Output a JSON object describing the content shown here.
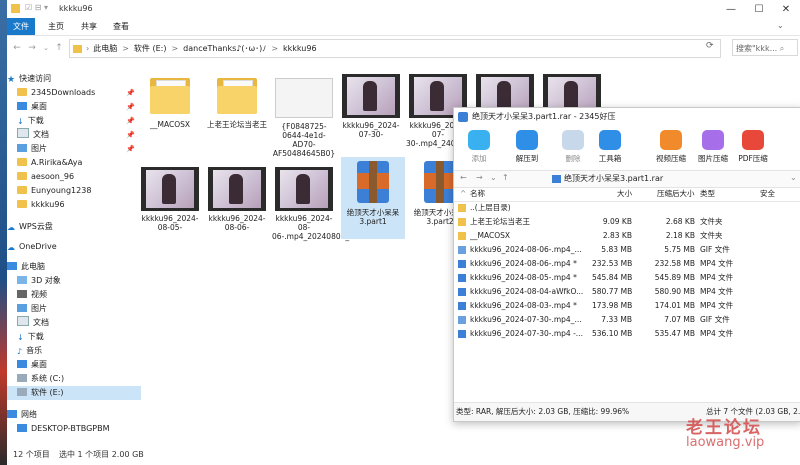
{
  "window": {
    "title": "kkkku96",
    "controls": [
      "—",
      "☐",
      "✕"
    ]
  },
  "ribbon": {
    "tabs": [
      "文件",
      "主页",
      "共享",
      "查看"
    ]
  },
  "address": {
    "parts": [
      "此电脑",
      ">",
      "软件 (E:)",
      ">",
      "danceThanks♪(･ω･)ﾉ",
      ">",
      "kkkku96"
    ],
    "search_placeholder": "搜索\"kkk..."
  },
  "nav": {
    "quick_access": "快速访问",
    "items": [
      {
        "label": "2345Downloads",
        "pinned": true,
        "icon": "folder-icon"
      },
      {
        "label": "桌面",
        "pinned": true,
        "icon": "desktop-icon"
      },
      {
        "label": "下载",
        "pinned": true,
        "icon": "download-icon"
      },
      {
        "label": "文档",
        "pinned": true,
        "icon": "document-icon"
      },
      {
        "label": "图片",
        "pinned": true,
        "icon": "picture-icon"
      },
      {
        "label": "A.Ririka&Aya",
        "pinned": false,
        "icon": "folder-icon"
      },
      {
        "label": "aesoon_96",
        "pinned": false,
        "icon": "folder-icon"
      },
      {
        "label": "Eunyoung1238",
        "pinned": false,
        "icon": "folder-icon"
      },
      {
        "label": "kkkku96",
        "pinned": false,
        "icon": "folder-icon"
      }
    ],
    "wps": "WPS云盘",
    "onedrive": "OneDrive",
    "this_pc": "此电脑",
    "pc_items": [
      "3D 对象",
      "视频",
      "图片",
      "文档",
      "下载",
      "音乐",
      "桌面",
      "系统 (C:)",
      "软件 (E:)"
    ],
    "network": "网络",
    "network_items": [
      "DESKTOP-BTBGPBM"
    ]
  },
  "files": [
    {
      "name": "__MACOSX",
      "kind": "folder"
    },
    {
      "name": "上老王论坛当老王",
      "kind": "folder"
    },
    {
      "name": "{F0848725-0644-4e1d-AD70-AF50484645B0}",
      "kind": "image"
    },
    {
      "name": "kkkku96_2024-07-30-",
      "kind": "video"
    },
    {
      "name": "kkkku96_2024-07-30-.mp4_240807_204...",
      "kind": "video"
    },
    {
      "name": "",
      "kind": "video"
    },
    {
      "name": "",
      "kind": "video"
    },
    {
      "name": "kkkku96_2024-08-05-",
      "kind": "video"
    },
    {
      "name": "kkkku96_2024-08-06-",
      "kind": "video"
    },
    {
      "name": "kkkku96_2024-08-06-.mp4_20240807_204948",
      "kind": "video"
    },
    {
      "name": "绝顶天才小呆呆3.part1",
      "kind": "rar",
      "selected": true
    },
    {
      "name": "绝顶天才小呆呆3.part2",
      "kind": "rar"
    }
  ],
  "status": {
    "count": "12 个项目",
    "selected": "选中 1 个项目  2.00 GB"
  },
  "rar": {
    "title": "绝顶天才小呆呆3.part1.rar - 2345好压",
    "toolbar": [
      "添加",
      "解压到",
      "删除",
      "工具箱",
      "视频压缩",
      "图片压缩",
      "PDF压缩"
    ],
    "path": "绝顶天才小呆呆3.part1.rar",
    "headers": [
      "名称",
      "大小",
      "压缩后大小",
      "类型",
      "安全"
    ],
    "rows": [
      {
        "name": "..(上层目录)",
        "size": "",
        "packed": "",
        "type": "",
        "icon": "up"
      },
      {
        "name": "上老王论坛当老王",
        "size": "9.09 KB",
        "packed": "2.68 KB",
        "type": "文件夹",
        "icon": "folder"
      },
      {
        "name": "__MACOSX",
        "size": "2.83 KB",
        "packed": "2.18 KB",
        "type": "文件夹",
        "icon": "folder"
      },
      {
        "name": "kkkku96_2024-08-06-.mp4_...",
        "size": "5.83 MB",
        "packed": "5.75 MB",
        "type": "GIF 文件",
        "icon": "gif"
      },
      {
        "name": "kkkku96_2024-08-06-.mp4 *",
        "size": "232.53 MB",
        "packed": "232.58 MB",
        "type": "MP4 文件",
        "icon": "mp4"
      },
      {
        "name": "kkkku96_2024-08-05-.mp4 *",
        "size": "545.84 MB",
        "packed": "545.89 MB",
        "type": "MP4 文件",
        "icon": "mp4"
      },
      {
        "name": "kkkku96_2024-08-04-aWfkO...",
        "size": "580.77 MB",
        "packed": "580.90 MB",
        "type": "MP4 文件",
        "icon": "mp4"
      },
      {
        "name": "kkkku96_2024-08-03-.mp4 *",
        "size": "173.98 MB",
        "packed": "174.01 MB",
        "type": "MP4 文件",
        "icon": "mp4"
      },
      {
        "name": "kkkku96_2024-07-30-.mp4_...",
        "size": "7.33 MB",
        "packed": "7.07 MB",
        "type": "GIF 文件",
        "icon": "gif"
      },
      {
        "name": "kkkku96_2024-07-30-.mp4 -...",
        "size": "536.10 MB",
        "packed": "535.47 MB",
        "type": "MP4 文件",
        "icon": "mp4"
      }
    ],
    "status_left": "类型: RAR, 解压后大小: 2.03 GB, 压缩比: 99.96%",
    "status_right": "总计 7 个文件 (2.03 GB, 2.1"
  },
  "watermark": {
    "line1": "老王论坛",
    "line2": "laowang.vip"
  }
}
